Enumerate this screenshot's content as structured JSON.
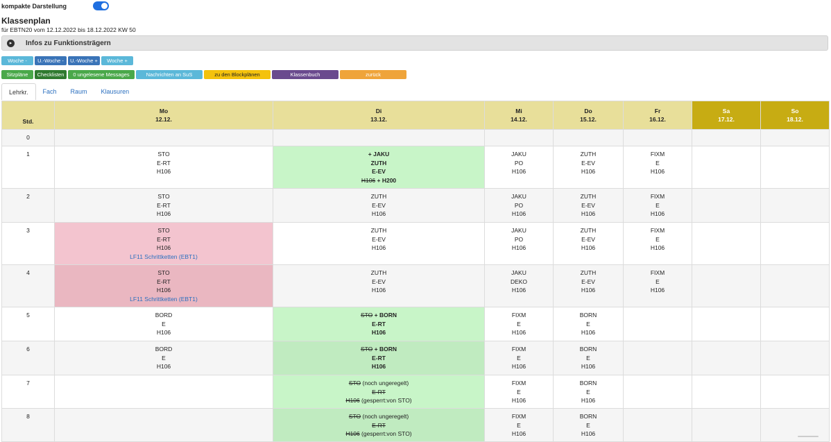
{
  "compact": {
    "label": "kompakte Darstellung",
    "on": true,
    "accent": "#1f6fe0"
  },
  "header": {
    "title": "Klassenplan",
    "subtitle": "für EBTN20 vom 12.12.2022 bis 18.12.2022 KW 50"
  },
  "info": {
    "label": "Infos zu Funktionsträgern",
    "icon": "chevron-right-circle-icon"
  },
  "nav_buttons": {
    "week_prev": "Woche -",
    "uweek_prev": "U.-Woche -",
    "uweek_next": "U.-Woche +",
    "week_next": "Woche +"
  },
  "action_buttons": {
    "seating": "Sitzpläne",
    "checklists": "Checklisten",
    "messages": "0 ungelesene Messages",
    "news": "Nachrichten an SuS",
    "blockplans": "zu den Blockplänen",
    "classbook": "Klassenbuch",
    "back": "zurück"
  },
  "tabs": {
    "teacher": "Lehrkr.",
    "subject": "Fach",
    "room": "Raum",
    "exams": "Klausuren"
  },
  "columns": {
    "std": "Std.",
    "mo": {
      "day": "Mo",
      "date": "12.12."
    },
    "di": {
      "day": "Di",
      "date": "13.12."
    },
    "mi": {
      "day": "Mi",
      "date": "14.12."
    },
    "do": {
      "day": "Do",
      "date": "15.12."
    },
    "fr": {
      "day": "Fr",
      "date": "16.12."
    },
    "sa": {
      "day": "Sa",
      "date": "17.12."
    },
    "so": {
      "day": "So",
      "date": "18.12."
    }
  },
  "rows": {
    "r0": {
      "num": "0"
    },
    "r1": {
      "num": "1",
      "mo": [
        "STO",
        "E-RT",
        "H106"
      ],
      "di": {
        "l1": "+ JAKU",
        "l2": "ZUTH",
        "l3": "E-EV",
        "l4a": "H106",
        "l4b": " + H200"
      },
      "mi": [
        "JAKU",
        "PO",
        "H106"
      ],
      "do": [
        "ZUTH",
        "E-EV",
        "H106"
      ],
      "fr": [
        "FIXM",
        "E",
        "H106"
      ]
    },
    "r2": {
      "num": "2",
      "mo": [
        "STO",
        "E-RT",
        "H106"
      ],
      "di": [
        "ZUTH",
        "E-EV",
        "H106"
      ],
      "mi": [
        "JAKU",
        "PO",
        "H106"
      ],
      "do": [
        "ZUTH",
        "E-EV",
        "H106"
      ],
      "fr": [
        "FIXM",
        "E",
        "H106"
      ]
    },
    "r3": {
      "num": "3",
      "mo": [
        "STO",
        "E-RT",
        "H106"
      ],
      "mo_link": "LF11 Schrittketten (EBT1)",
      "di": [
        "ZUTH",
        "E-EV",
        "H106"
      ],
      "mi": [
        "JAKU",
        "PO",
        "H106"
      ],
      "do": [
        "ZUTH",
        "E-EV",
        "H106"
      ],
      "fr": [
        "FIXM",
        "E",
        "H106"
      ]
    },
    "r4": {
      "num": "4",
      "mo": [
        "STO",
        "E-RT",
        "H106"
      ],
      "mo_link": "LF11 Schrittketten (EBT1)",
      "di": [
        "ZUTH",
        "E-EV",
        "H106"
      ],
      "mi": [
        "JAKU",
        "DEKO",
        "H106"
      ],
      "do": [
        "ZUTH",
        "E-EV",
        "H106"
      ],
      "fr": [
        "FIXM",
        "E",
        "H106"
      ]
    },
    "r5": {
      "num": "5",
      "mo": [
        "BORD",
        "E",
        "H106"
      ],
      "di": {
        "old": "STO",
        "new": " + BORN",
        "l2": "E-RT",
        "l3": "H106"
      },
      "mi": [
        "FIXM",
        "E",
        "H106"
      ],
      "do": [
        "BORN",
        "E",
        "H106"
      ]
    },
    "r6": {
      "num": "6",
      "mo": [
        "BORD",
        "E",
        "H106"
      ],
      "di": {
        "old": "STO",
        "new": " + BORN",
        "l2": "E-RT",
        "l3": "H106"
      },
      "mi": [
        "FIXM",
        "E",
        "H106"
      ],
      "do": [
        "BORN",
        "E",
        "H106"
      ]
    },
    "r7": {
      "num": "7",
      "di": {
        "t1": "STO",
        "n1": " (noch ungeregelt)",
        "t2": "E-RT",
        "t3": "H106",
        "n3": " (gesperrt:von STO)"
      },
      "mi": [
        "FIXM",
        "E",
        "H106"
      ],
      "do": [
        "BORN",
        "E",
        "H106"
      ]
    },
    "r8": {
      "num": "8",
      "di": {
        "t1": "STO",
        "n1": " (noch ungeregelt)",
        "t2": "E-RT",
        "t3": "H106",
        "n3": " (gesperrt:von STO)"
      },
      "mi": [
        "FIXM",
        "E",
        "H106"
      ],
      "do": [
        "BORN",
        "E",
        "H106"
      ]
    }
  }
}
